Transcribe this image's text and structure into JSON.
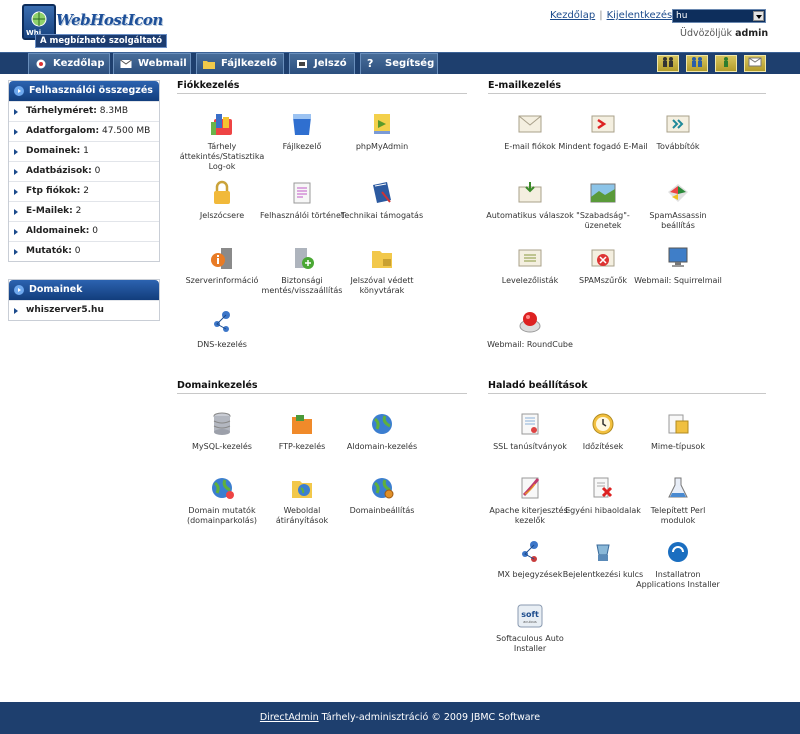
{
  "header": {
    "logo_name": "WebHostIcon",
    "logo_small": "Whi",
    "logo_tagline": "A megbízható szolgáltató",
    "links": [
      "Kezdőlap",
      "Kijelentkezés"
    ],
    "lang_value": "hu",
    "welcome_prefix": "Üdvözöljük",
    "welcome_user": "admin"
  },
  "nav": {
    "tabs": [
      "Kezdőlap",
      "Webmail",
      "Fájlkezelő",
      "Jelszó",
      "Segítség"
    ]
  },
  "sidebar": {
    "summary_title": "Felhasználói összegzés",
    "stats": [
      {
        "label": "Tárhelyméret:",
        "value": "8.3MB"
      },
      {
        "label": "Adatforgalom:",
        "value": "47.500 MB"
      },
      {
        "label": "Domainek:",
        "value": "1"
      },
      {
        "label": "Adatbázisok:",
        "value": "0"
      },
      {
        "label": "Ftp fiókok:",
        "value": "2"
      },
      {
        "label": "E-Mailek:",
        "value": "2"
      },
      {
        "label": "Aldomainek:",
        "value": "0"
      },
      {
        "label": "Mutatók:",
        "value": "0"
      }
    ],
    "domains_title": "Domainek",
    "domains": [
      "whiszerver5.hu"
    ]
  },
  "sections": {
    "fiokkezeles": {
      "title": "Fiókkezelés",
      "items": [
        "Tárhely áttekintés/Statisztika Log-ok",
        "Fájlkezelő",
        "phpMyAdmin",
        "Jelszócsere",
        "Felhasználói történet",
        "Technikai támogatás",
        "Szerverinformáció",
        "Biztonsági mentés/visszaállítás",
        "Jelszóval védett könyvtárak",
        "DNS-kezelés"
      ]
    },
    "emailkezeles": {
      "title": "E-mailkezelés",
      "items": [
        "E-mail fiókok",
        "Mindent fogadó E-Mail",
        "Továbbítók",
        "Automatikus válaszok",
        "\"Szabadság\"-üzenetek",
        "SpamAssassin beállítás",
        "Levelezőlisták",
        "SPAMszűrők",
        "Webmail: Squirrelmail",
        "Webmail: RoundCube"
      ]
    },
    "domainkezeles": {
      "title": "Domainkezelés",
      "items": [
        "MySQL-kezelés",
        "FTP-kezelés",
        "Aldomain-kezelés",
        "Domain mutatók (domainparkolás)",
        "Weboldal átirányítások",
        "Domainbeállítás"
      ]
    },
    "halado": {
      "title": "Haladó beállítások",
      "items": [
        "SSL tanúsítványok",
        "Időzítések",
        "Mime-típusok",
        "Apache kiterjesztés-kezelők",
        "Egyéni hibaoldalak",
        "Telepített Perl modulok",
        "MX bejegyzések",
        "Bejelentkezési kulcs",
        "Installatron Applications Installer",
        "Softaculous Auto Installer"
      ]
    }
  },
  "icon_text": {
    "soft_big": "soft",
    "soft_small": "aculous"
  },
  "footer": {
    "link": "DirectAdmin",
    "text": " Tárhely-adminisztráció © 2009 JBMC Software"
  },
  "colors": {
    "navy": "#1e3f6e",
    "accent": "#1c4b8c"
  }
}
